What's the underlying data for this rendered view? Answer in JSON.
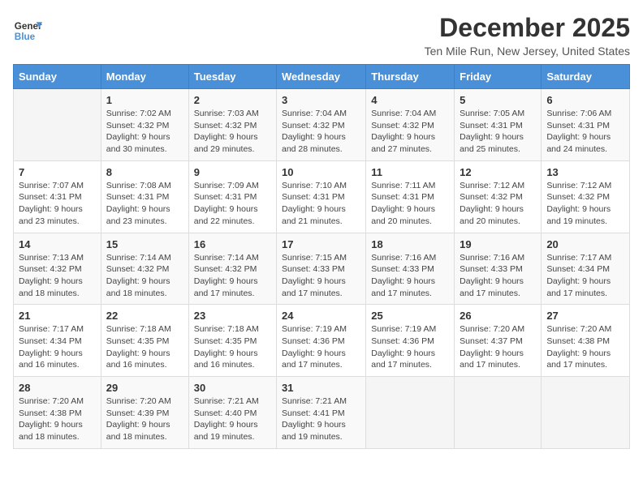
{
  "header": {
    "logo_line1": "General",
    "logo_line2": "Blue",
    "title": "December 2025",
    "subtitle": "Ten Mile Run, New Jersey, United States"
  },
  "columns": [
    "Sunday",
    "Monday",
    "Tuesday",
    "Wednesday",
    "Thursday",
    "Friday",
    "Saturday"
  ],
  "weeks": [
    [
      {
        "num": "",
        "info": ""
      },
      {
        "num": "1",
        "info": "Sunrise: 7:02 AM\nSunset: 4:32 PM\nDaylight: 9 hours\nand 30 minutes."
      },
      {
        "num": "2",
        "info": "Sunrise: 7:03 AM\nSunset: 4:32 PM\nDaylight: 9 hours\nand 29 minutes."
      },
      {
        "num": "3",
        "info": "Sunrise: 7:04 AM\nSunset: 4:32 PM\nDaylight: 9 hours\nand 28 minutes."
      },
      {
        "num": "4",
        "info": "Sunrise: 7:04 AM\nSunset: 4:32 PM\nDaylight: 9 hours\nand 27 minutes."
      },
      {
        "num": "5",
        "info": "Sunrise: 7:05 AM\nSunset: 4:31 PM\nDaylight: 9 hours\nand 25 minutes."
      },
      {
        "num": "6",
        "info": "Sunrise: 7:06 AM\nSunset: 4:31 PM\nDaylight: 9 hours\nand 24 minutes."
      }
    ],
    [
      {
        "num": "7",
        "info": "Sunrise: 7:07 AM\nSunset: 4:31 PM\nDaylight: 9 hours\nand 23 minutes."
      },
      {
        "num": "8",
        "info": "Sunrise: 7:08 AM\nSunset: 4:31 PM\nDaylight: 9 hours\nand 23 minutes."
      },
      {
        "num": "9",
        "info": "Sunrise: 7:09 AM\nSunset: 4:31 PM\nDaylight: 9 hours\nand 22 minutes."
      },
      {
        "num": "10",
        "info": "Sunrise: 7:10 AM\nSunset: 4:31 PM\nDaylight: 9 hours\nand 21 minutes."
      },
      {
        "num": "11",
        "info": "Sunrise: 7:11 AM\nSunset: 4:31 PM\nDaylight: 9 hours\nand 20 minutes."
      },
      {
        "num": "12",
        "info": "Sunrise: 7:12 AM\nSunset: 4:32 PM\nDaylight: 9 hours\nand 20 minutes."
      },
      {
        "num": "13",
        "info": "Sunrise: 7:12 AM\nSunset: 4:32 PM\nDaylight: 9 hours\nand 19 minutes."
      }
    ],
    [
      {
        "num": "14",
        "info": "Sunrise: 7:13 AM\nSunset: 4:32 PM\nDaylight: 9 hours\nand 18 minutes."
      },
      {
        "num": "15",
        "info": "Sunrise: 7:14 AM\nSunset: 4:32 PM\nDaylight: 9 hours\nand 18 minutes."
      },
      {
        "num": "16",
        "info": "Sunrise: 7:14 AM\nSunset: 4:32 PM\nDaylight: 9 hours\nand 17 minutes."
      },
      {
        "num": "17",
        "info": "Sunrise: 7:15 AM\nSunset: 4:33 PM\nDaylight: 9 hours\nand 17 minutes."
      },
      {
        "num": "18",
        "info": "Sunrise: 7:16 AM\nSunset: 4:33 PM\nDaylight: 9 hours\nand 17 minutes."
      },
      {
        "num": "19",
        "info": "Sunrise: 7:16 AM\nSunset: 4:33 PM\nDaylight: 9 hours\nand 17 minutes."
      },
      {
        "num": "20",
        "info": "Sunrise: 7:17 AM\nSunset: 4:34 PM\nDaylight: 9 hours\nand 17 minutes."
      }
    ],
    [
      {
        "num": "21",
        "info": "Sunrise: 7:17 AM\nSunset: 4:34 PM\nDaylight: 9 hours\nand 16 minutes."
      },
      {
        "num": "22",
        "info": "Sunrise: 7:18 AM\nSunset: 4:35 PM\nDaylight: 9 hours\nand 16 minutes."
      },
      {
        "num": "23",
        "info": "Sunrise: 7:18 AM\nSunset: 4:35 PM\nDaylight: 9 hours\nand 16 minutes."
      },
      {
        "num": "24",
        "info": "Sunrise: 7:19 AM\nSunset: 4:36 PM\nDaylight: 9 hours\nand 17 minutes."
      },
      {
        "num": "25",
        "info": "Sunrise: 7:19 AM\nSunset: 4:36 PM\nDaylight: 9 hours\nand 17 minutes."
      },
      {
        "num": "26",
        "info": "Sunrise: 7:20 AM\nSunset: 4:37 PM\nDaylight: 9 hours\nand 17 minutes."
      },
      {
        "num": "27",
        "info": "Sunrise: 7:20 AM\nSunset: 4:38 PM\nDaylight: 9 hours\nand 17 minutes."
      }
    ],
    [
      {
        "num": "28",
        "info": "Sunrise: 7:20 AM\nSunset: 4:38 PM\nDaylight: 9 hours\nand 18 minutes."
      },
      {
        "num": "29",
        "info": "Sunrise: 7:20 AM\nSunset: 4:39 PM\nDaylight: 9 hours\nand 18 minutes."
      },
      {
        "num": "30",
        "info": "Sunrise: 7:21 AM\nSunset: 4:40 PM\nDaylight: 9 hours\nand 19 minutes."
      },
      {
        "num": "31",
        "info": "Sunrise: 7:21 AM\nSunset: 4:41 PM\nDaylight: 9 hours\nand 19 minutes."
      },
      {
        "num": "",
        "info": ""
      },
      {
        "num": "",
        "info": ""
      },
      {
        "num": "",
        "info": ""
      }
    ]
  ]
}
